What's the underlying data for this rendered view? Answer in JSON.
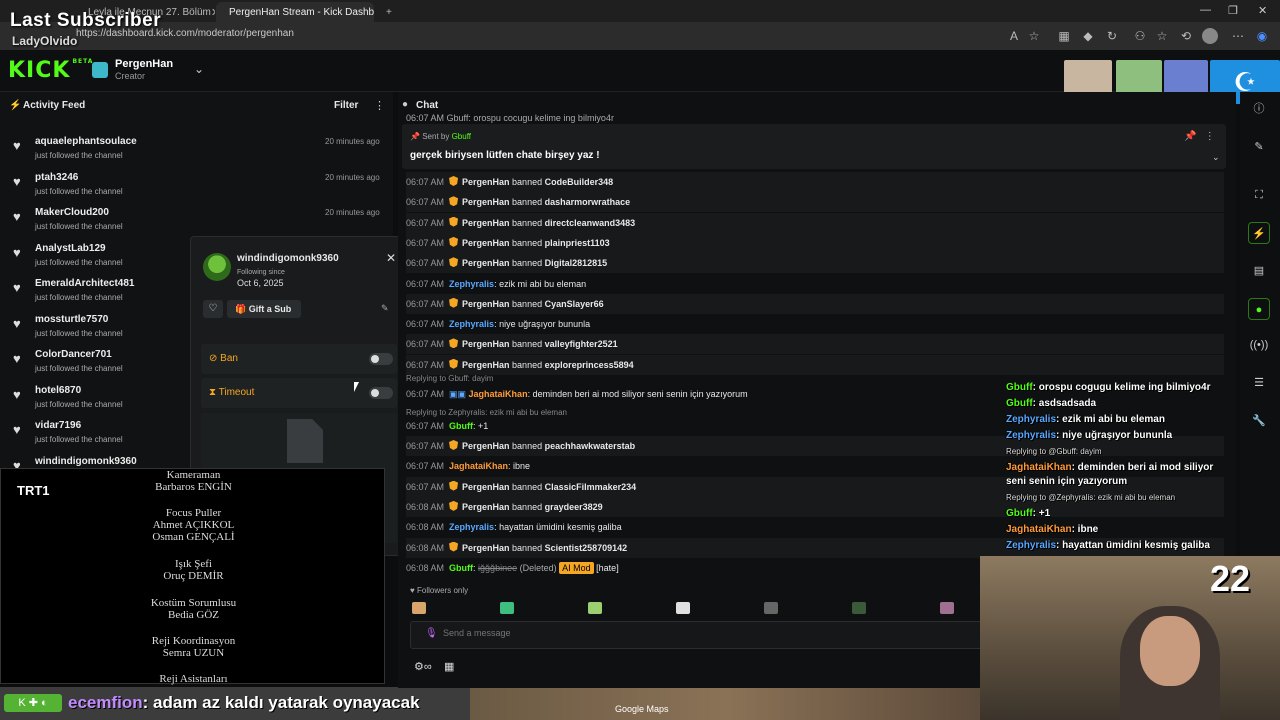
{
  "overlay": {
    "title": "Last Subscriber",
    "name": "LadyOlvido"
  },
  "browser": {
    "tabs": [
      {
        "label": "Leyla ile Mecnun 27. Bölüm",
        "active": false
      },
      {
        "label": "PergenHan Stream - Kick Dashbo",
        "active": true
      }
    ],
    "url": "https://dashboard.kick.com/moderator/pergenhan"
  },
  "header": {
    "logo": "KICK",
    "logo_beta": "BETA",
    "channel": "PergenHan",
    "role": "Creator"
  },
  "feed": {
    "title": "Activity Feed",
    "filter": "Filter",
    "items": [
      {
        "user": "aquaelephantsoulace",
        "sub": "just followed the channel",
        "time": "20 minutes ago"
      },
      {
        "user": "ptah3246",
        "sub": "just followed the channel",
        "time": "20 minutes ago"
      },
      {
        "user": "MakerCloud200",
        "sub": "just followed the channel",
        "time": "20 minutes ago"
      },
      {
        "user": "AnalystLab129",
        "sub": "just followed the channel",
        "time": ""
      },
      {
        "user": "EmeraldArchitect481",
        "sub": "just followed the channel",
        "time": ""
      },
      {
        "user": "mossturtle7570",
        "sub": "just followed the channel",
        "time": ""
      },
      {
        "user": "ColorDancer701",
        "sub": "just followed the channel",
        "time": ""
      },
      {
        "user": "hotel6870",
        "sub": "just followed the channel",
        "time": ""
      },
      {
        "user": "vidar7196",
        "sub": "just followed the channel",
        "time": ""
      },
      {
        "user": "windindigomonk9360",
        "sub": "",
        "time": ""
      }
    ]
  },
  "popup": {
    "user": "windindigomonk9360",
    "following_since_label": "Following since",
    "date": "Oct 6, 2025",
    "gift_label": "Gift a Sub",
    "ban_label": "Ban",
    "timeout_label": "Timeout"
  },
  "credits": {
    "logo": "TRT1",
    "lines": [
      "Kameraman",
      "Barbaros ENGİN",
      "Focus Puller",
      "Ahmet AÇIKKOL",
      "Osman GENÇALİ",
      "Işık Şefi",
      "Oruç DEMİR",
      "Kostüm Sorumlusu",
      "Bedia GÖZ",
      "Reji Koordinasyon",
      "Semra UZUN",
      "Reji Asistanları"
    ]
  },
  "ticker": {
    "name": "ecemfion",
    "text": ": adam az kaldı yatarak oynayacak"
  },
  "chat": {
    "title": "Chat",
    "truncated_top": "06:07 AM  Gbuff: orospu cocugu kelime ing bilmiyo4r",
    "pinned": {
      "sent_by_label": "Sent by",
      "sender": "Gbuff",
      "text": "gerçek biriysen lütfen chate birşey yaz !"
    },
    "messages": [
      {
        "time": "06:07 AM",
        "user": "PergenHan",
        "action": "banned",
        "target": "CodeBuilder348",
        "mod": true
      },
      {
        "time": "06:07 AM",
        "user": "PergenHan",
        "action": "banned",
        "target": "dasharmorwrathace",
        "mod": true
      },
      {
        "time": "06:07 AM",
        "user": "PergenHan",
        "action": "banned",
        "target": "directcleanwand3483",
        "mod": true
      },
      {
        "time": "06:07 AM",
        "user": "PergenHan",
        "action": "banned",
        "target": "plainpriest1103",
        "mod": true
      },
      {
        "time": "06:07 AM",
        "user": "PergenHan",
        "action": "banned",
        "target": "Digital2812815",
        "mod": true
      },
      {
        "time": "06:07 AM",
        "user": "Zephyralis",
        "text": ": ezik mi abi bu eleman",
        "mod": false
      },
      {
        "time": "06:07 AM",
        "user": "PergenHan",
        "action": "banned",
        "target": "CyanSlayer66",
        "mod": true
      },
      {
        "time": "06:07 AM",
        "user": "Zephyralis",
        "text": ": niye uğraşıyor bununla",
        "mod": false
      },
      {
        "time": "06:07 AM",
        "user": "PergenHan",
        "action": "banned",
        "target": "valleyfighter2521",
        "mod": true
      },
      {
        "time": "06:07 AM",
        "user": "PergenHan",
        "action": "banned",
        "target": "exploreprincess5894",
        "mod": true
      }
    ],
    "reply1": "Replying to Gbuff: dayim",
    "jag1_user": "JaghataiKhan",
    "jag1_text": ": deminden beri ai mod siliyor seni senin için yazıyorum",
    "reply2": "Replying to Zephyralis: ezik mi abi bu eleman",
    "gbuff_time": "06:07 AM",
    "gbuff_user": "Gbuff",
    "gbuff_text": ": +1",
    "after": [
      {
        "time": "06:07 AM",
        "user": "PergenHan",
        "action": "banned",
        "target": "peachhawkwaterstab"
      },
      {
        "time": "06:07 AM",
        "user": "JaghataiKhan",
        "text": ": ibne"
      },
      {
        "time": "06:07 AM",
        "user": "PergenHan",
        "action": "banned",
        "target": "ClassicFilmmaker234"
      },
      {
        "time": "06:08 AM",
        "user": "PergenHan",
        "action": "banned",
        "target": "graydeer3829"
      },
      {
        "time": "06:08 AM",
        "user": "Zephyralis",
        "text": ": hayattan ümidini kesmiş galiba"
      },
      {
        "time": "06:08 AM",
        "user": "PergenHan",
        "action": "banned",
        "target": "Scientist258709142"
      }
    ],
    "deleted": {
      "time": "06:08 AM",
      "user": "Gbuff",
      "text": "iğğğbinee",
      "deleted_label": "(Deleted)",
      "ai_label": "AI Mod",
      "tag": "[hate]"
    },
    "followers_only": "Followers only",
    "input_placeholder": "Send a message"
  },
  "stream_chat": [
    {
      "user": "Gbuff",
      "text": ": orospu cogugu kelime ing bilmiyo4r"
    },
    {
      "user": "Gbuff",
      "text": ": asdsadsada"
    },
    {
      "user": "Zephyralis",
      "text": ": ezik mi abi bu eleman"
    },
    {
      "user": "Zephyralis",
      "text": ": niye uğraşıyor bununla"
    },
    {
      "reply": "Replying to @Gbuff: dayim"
    },
    {
      "user": "JaghataiKhan",
      "text": ": deminden beri ai mod siliyor"
    },
    {
      "text": "seni senin için yazıyorum"
    },
    {
      "reply": "Replying to @Zephyralis: ezik mi abi bu eleman"
    },
    {
      "user": "Gbuff",
      "text": ": +1"
    },
    {
      "user": "JaghataiKhan",
      "text": ": ibne"
    },
    {
      "user": "Zephyralis",
      "text": ": hayattan ümidini kesmiş galiba"
    }
  ],
  "webcam": {
    "count": "22"
  },
  "map": {
    "label": "Google Maps"
  },
  "colors": {
    "kick_green": "#53fc18",
    "mod_orange": "#f5a623",
    "blue_user": "#5aa8ff"
  }
}
